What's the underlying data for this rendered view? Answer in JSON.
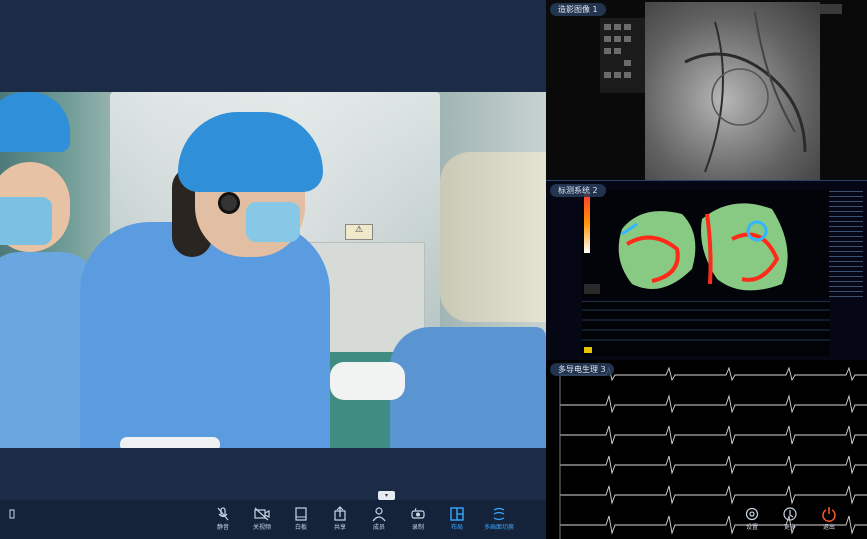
{
  "panels": {
    "xray_label": "造影图像 1",
    "map_label": "标测系统 2",
    "ecg_label": "多导电生理 3"
  },
  "toolbar": {
    "items": [
      {
        "icon": "mic-mute-icon",
        "label": "静音"
      },
      {
        "icon": "camera-off-icon",
        "label": "关视频"
      },
      {
        "icon": "whiteboard-icon",
        "label": "白板"
      },
      {
        "icon": "doc-share-icon",
        "label": "共享"
      },
      {
        "icon": "participants-icon",
        "label": "成员"
      },
      {
        "icon": "record-icon",
        "label": "录制"
      },
      {
        "icon": "layout-icon",
        "label": "布局"
      },
      {
        "icon": "multi-screen-icon",
        "label": "多画面切换"
      }
    ],
    "right_items": [
      {
        "icon": "settings-icon",
        "label": "设置"
      },
      {
        "icon": "more-icon",
        "label": "更多"
      },
      {
        "icon": "power-icon",
        "label": "退出"
      }
    ],
    "left_edge_label": "",
    "active_index": 6
  },
  "colors": {
    "accent": "#37a8ff",
    "end_call": "#ff5a2a",
    "background": "#1c2b46"
  }
}
